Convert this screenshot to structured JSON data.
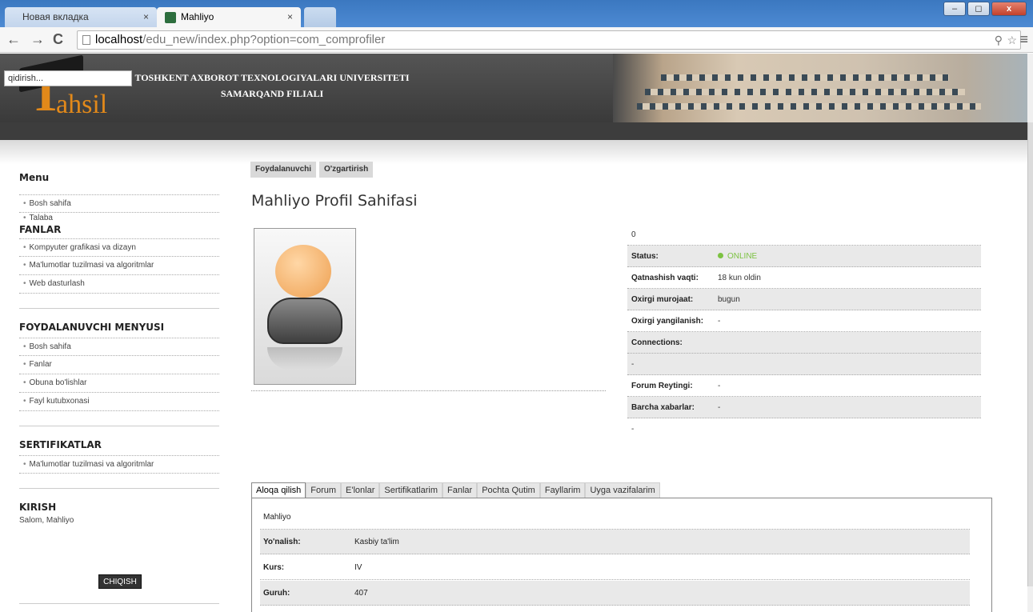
{
  "browser": {
    "tabs": [
      {
        "title": "Новая вкладка",
        "close": "×"
      },
      {
        "title": "Mahliyo",
        "close": "×"
      }
    ],
    "url_host": "localhost",
    "url_path": "/edu_new/index.php?option=com_comprofiler",
    "nav": {
      "back": "←",
      "forward": "→",
      "reload": "C"
    },
    "window_controls": {
      "minimize": "‒",
      "maximize": "◻",
      "close": "x"
    },
    "toolbar_icons": {
      "zoom": "⚲",
      "star": "☆",
      "menu": "≡"
    }
  },
  "site": {
    "logo_letter": "T",
    "logo_word": "ahsil",
    "title_line1": "TOSHKENT AXBOROT TEXNOLOGIYALARI UNIVERSITETI",
    "title_line2": "SAMARQAND FILIALI",
    "search_placeholder": "qidirish..."
  },
  "sidebar": {
    "menu_heading": "Menu",
    "menu_items": [
      "Bosh sahifa",
      "Talaba"
    ],
    "fanlar_heading": "FANLAR",
    "fanlar_items": [
      "Kompyuter grafikasi va dizayn",
      "Ma'lumotlar tuzilmasi va algoritmlar",
      "Web dasturlash"
    ],
    "user_menu_heading": "FOYDALANUVCHI MENYUSI",
    "user_menu_items": [
      "Bosh sahifa",
      "Fanlar",
      "Obuna bo'lishlar",
      "Fayl kutubxonasi"
    ],
    "cert_heading": "SERTIFIKATLAR",
    "cert_items": [
      "Ma'lumotlar tuzilmasi va algoritmlar"
    ],
    "login_heading": "KIRISH",
    "greeting": "Salom, Mahliyo",
    "logout_label": "CHIQISH"
  },
  "main": {
    "subtabs": [
      "Foydalanuvchi",
      "O'zgartirish"
    ],
    "title": "Mahliyo Profil Sahifasi",
    "hits": "0",
    "info": [
      {
        "k": "Status:",
        "v": "ONLINE"
      },
      {
        "k": "Qatnashish vaqti:",
        "v": "18 kun oldin"
      },
      {
        "k": "Oxirgi murojaat:",
        "v": "bugun"
      },
      {
        "k": "Oxirgi yangilanish:",
        "v": "-"
      },
      {
        "k": "Connections:",
        "v": ""
      },
      {
        "k": "-",
        "v": ""
      },
      {
        "k": "Forum Reytingi:",
        "v": "-"
      },
      {
        "k": "Barcha xabarlar:",
        "v": "-"
      },
      {
        "k": "-",
        "v": ""
      }
    ],
    "profile_tabs": [
      "Aloqa qilish",
      "Forum",
      "E'lonlar",
      "Sertifikatlarim",
      "Fanlar",
      "Pochta Qutim",
      "Fayllarim",
      "Uyga vazifalarim"
    ],
    "panel_name": "Mahliyo",
    "panel_rows": [
      {
        "k": "Yo'nalish:",
        "v": "Kasbiy ta'lim"
      },
      {
        "k": "Kurs:",
        "v": "IV"
      },
      {
        "k": "Guruh:",
        "v": "407"
      }
    ],
    "status_color": "#7cc242"
  }
}
